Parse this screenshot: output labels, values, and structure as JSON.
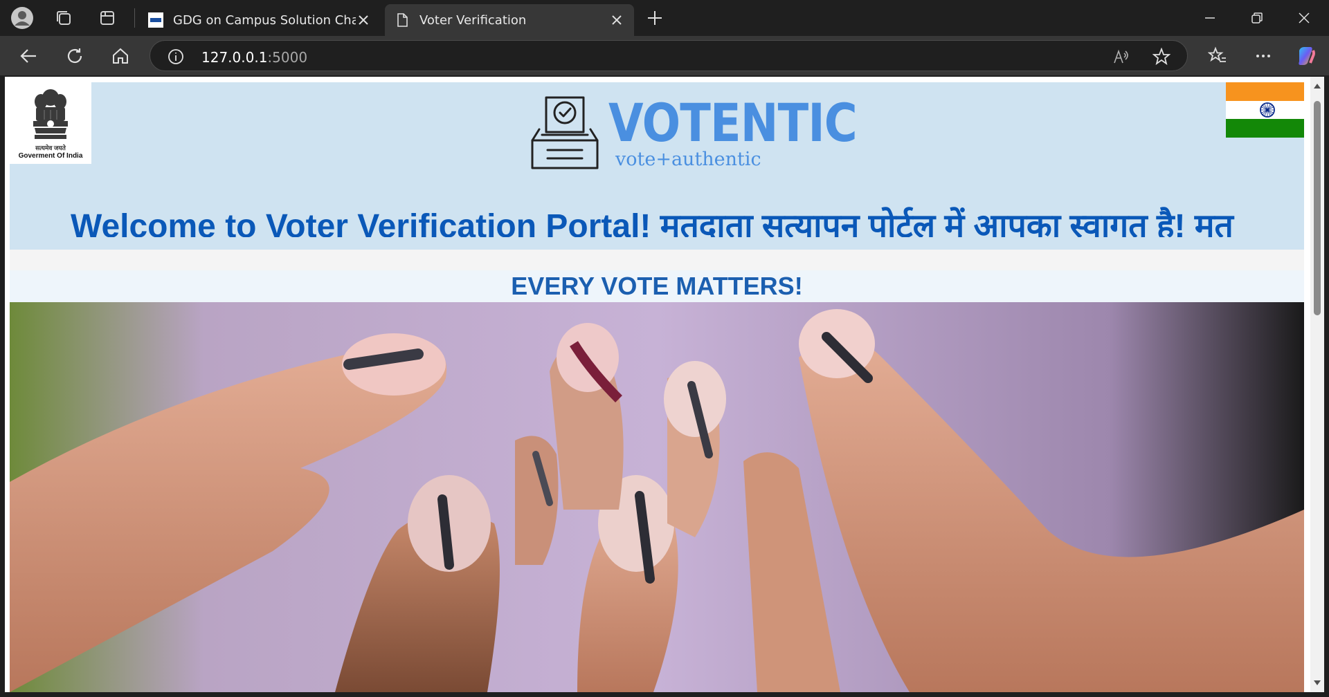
{
  "browser": {
    "tabs": [
      {
        "title": "GDG on Campus Solution Challen",
        "active": false
      },
      {
        "title": "Voter Verification",
        "active": true
      }
    ],
    "url_host": "127.0.0.1",
    "url_port": ":5000",
    "icons": [
      "profile-icon",
      "workspaces-icon",
      "tab-actions-icon",
      "close-icon",
      "new-tab-icon",
      "minimize-icon",
      "restore-icon",
      "window-close-icon",
      "back-icon",
      "refresh-icon",
      "home-icon",
      "site-info-icon",
      "read-aloud-icon",
      "favorite-star-icon",
      "favorites-icon",
      "more-icon",
      "copilot-icon"
    ]
  },
  "page": {
    "emblem_hindi": "सत्यमेव जयते",
    "emblem_caption": "Goverment Of India",
    "logo_word": "VOTENTIC",
    "logo_tagline": "vote+authentic",
    "marquee_text": "Welcome to Voter Verification Portal! मतदाता सत्यापन पोर्टल में आपका स्वागत है! मत",
    "motto": "EVERY VOTE MATTERS!",
    "colors": {
      "header_bg": "#cfe3f1",
      "brand_blue": "#4a8fe0",
      "marquee_blue": "#0a58b8",
      "motto_blue": "#1b5fb0"
    }
  }
}
